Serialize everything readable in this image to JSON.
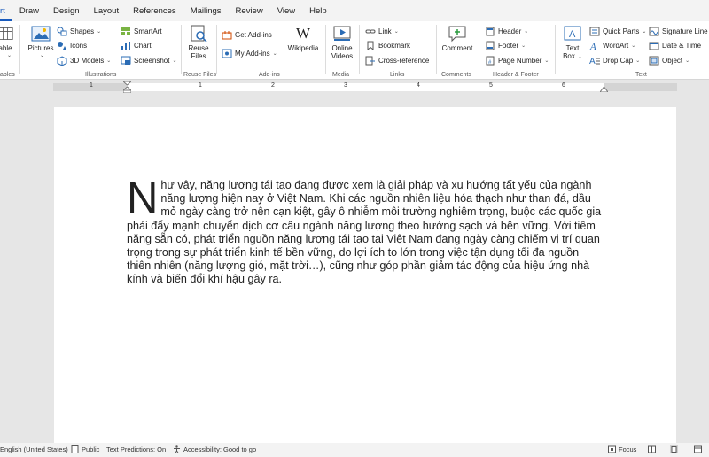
{
  "tabs": [
    "rt",
    "Draw",
    "Design",
    "Layout",
    "References",
    "Mailings",
    "Review",
    "View",
    "Help"
  ],
  "ribbon": {
    "tables": {
      "label": "able",
      "group": "ables"
    },
    "illustrations": {
      "pictures": "Pictures",
      "shapes": "Shapes",
      "icons": "Icons",
      "models3d": "3D Models",
      "smartart": "SmartArt",
      "chart": "Chart",
      "screenshot": "Screenshot",
      "group": "Illustrations"
    },
    "reuse": {
      "label1": "Reuse",
      "label2": "Files",
      "group": "Reuse Files"
    },
    "addins": {
      "get": "Get Add-ins",
      "my": "My Add-ins",
      "wikipedia": "Wikipedia",
      "group": "Add-ins"
    },
    "media": {
      "label1": "Online",
      "label2": "Videos",
      "group": "Media"
    },
    "links": {
      "link": "Link",
      "bookmark": "Bookmark",
      "cross": "Cross-reference",
      "group": "Links"
    },
    "comments": {
      "comment": "Comment",
      "group": "Comments"
    },
    "header_footer": {
      "header": "Header",
      "footer": "Footer",
      "page_number": "Page Number",
      "group": "Header & Footer"
    },
    "text": {
      "textbox1": "Text",
      "textbox2": "Box",
      "quickparts": "Quick Parts",
      "wordart": "WordArt",
      "dropcap": "Drop Cap",
      "signature": "Signature Line",
      "datetime": "Date & Time",
      "object": "Object",
      "group": "Text"
    }
  },
  "ruler": {
    "numbers": [
      "1",
      "1",
      "2",
      "3",
      "4",
      "5",
      "6"
    ]
  },
  "document": {
    "dropcap": "N",
    "paragraph": "hư vậy, năng lượng tái tạo đang được xem là giải pháp và xu hướng tất yếu của ngành năng lượng hiện nay ở Việt Nam. Khi các nguồn nhiên liệu hóa thạch như than đá, dầu mỏ ngày càng trở nên cạn kiệt, gây ô nhiễm môi trường nghiêm trọng, buộc các quốc gia phải đẩy mạnh chuyển dịch cơ cấu ngành năng lượng theo hướng sạch và bền vững. Với tiềm năng sẵn có, phát triển nguồn năng lượng tái tạo tại Việt Nam đang ngày càng chiếm vị trí quan trọng trong sự phát triển kinh tế bền vững, do lợi ích to lớn trong việc tận dụng tối đa nguồn thiên nhiên (năng lượng gió, mặt trời…), cũng như góp phần giảm tác động của hiệu ứng nhà kính và biến đổi khí hậu gây ra."
  },
  "status": {
    "language": "English (United States)",
    "public": "Public",
    "predictions": "Text Predictions: On",
    "accessibility": "Accessibility: Good to go",
    "focus": "Focus"
  },
  "colors": {
    "accent": "#185abd",
    "ribbon_bg": "#ffffff",
    "canvas": "#e6e6e6"
  }
}
